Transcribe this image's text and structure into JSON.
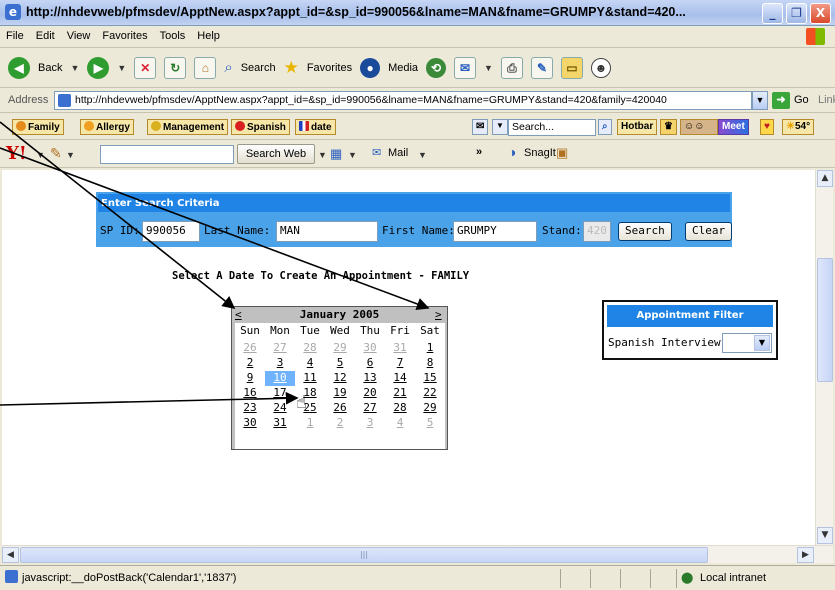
{
  "window": {
    "title": "http://nhdevweb/pfmsdev/ApptNew.aspx?appt_id=&sp_id=990056&lname=MAN&fname=GRUMPY&stand=420...",
    "minimize": "_",
    "restore": "❐",
    "close": "X"
  },
  "menu": [
    "File",
    "Edit",
    "View",
    "Favorites",
    "Tools",
    "Help"
  ],
  "toolbar": {
    "back": "Back",
    "search": "Search",
    "favorites": "Favorites",
    "media": "Media"
  },
  "address": {
    "label": "Address",
    "url": "http://nhdevweb/pfmsdev/ApptNew.aspx?appt_id=&sp_id=990056&lname=MAN&fname=GRUMPY&stand=420&family=420040",
    "go": "Go",
    "links": "Links"
  },
  "links_bar": {
    "family": "Family",
    "allergy": "Allergy",
    "management": "Management",
    "spanish": "Spanish",
    "date": "date",
    "search_placeholder": "Search...",
    "hotbar": "Hotbar",
    "meet": "Meet",
    "weather": "54°"
  },
  "yahoo_bar": {
    "logo": "Y!",
    "search_web": "Search Web",
    "mail": "Mail",
    "more": "»",
    "snagit": "SnagIt"
  },
  "criteria": {
    "header": "Enter Search Criteria",
    "sp_id_label": "SP ID:",
    "sp_id_value": "990056",
    "last_name_label": "Last Name:",
    "last_name_value": "MAN",
    "first_name_label": "First Name:",
    "first_name_value": "GRUMPY",
    "stand_label": "Stand:",
    "stand_value": "420",
    "search_button": "Search",
    "clear_button": "Clear"
  },
  "prompt": "Select A Date To Create An Appointment - FAMILY",
  "calendar": {
    "prev": "<",
    "next": ">",
    "title": "January 2005",
    "weekdays": [
      "Sun",
      "Mon",
      "Tue",
      "Wed",
      "Thu",
      "Fri",
      "Sat"
    ],
    "weeks": [
      [
        "26",
        "27",
        "28",
        "29",
        "30",
        "31",
        "1"
      ],
      [
        "2",
        "3",
        "4",
        "5",
        "6",
        "7",
        "8"
      ],
      [
        "9",
        "10",
        "11",
        "12",
        "13",
        "14",
        "15"
      ],
      [
        "16",
        "17",
        "18",
        "19",
        "20",
        "21",
        "22"
      ],
      [
        "23",
        "24",
        "25",
        "26",
        "27",
        "28",
        "29"
      ],
      [
        "30",
        "31",
        "1",
        "2",
        "3",
        "4",
        "5"
      ]
    ],
    "selected": "10"
  },
  "filter": {
    "header": "Appointment Filter",
    "label": "Spanish Interview",
    "value": ""
  },
  "status": {
    "text": "javascript:__doPostBack('Calendar1','1837')",
    "zone": "Local intranet"
  },
  "colors": {
    "header_blue": "#1f84e6",
    "criteria_bg": "#4aa2e8",
    "selected_day": "#6fb3ff",
    "calendar_frame": "#c0c0c0"
  }
}
